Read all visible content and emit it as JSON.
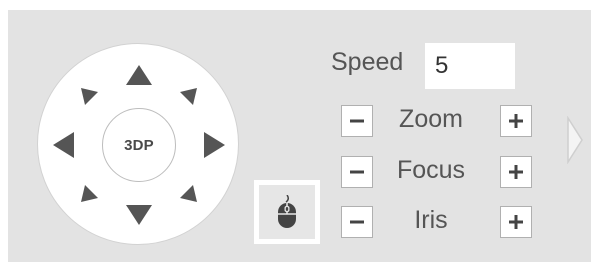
{
  "ptz": {
    "center_label": "3DP",
    "directions": [
      "up",
      "up-right",
      "right",
      "down-right",
      "down",
      "down-left",
      "left",
      "up-left"
    ]
  },
  "speed": {
    "label": "Speed",
    "value": "5"
  },
  "controls": [
    {
      "label": "Zoom"
    },
    {
      "label": "Focus"
    },
    {
      "label": "Iris"
    }
  ],
  "icons": {
    "mouse": "mouse-icon",
    "expand": "chevron-right-icon",
    "minus": "minus-icon",
    "plus": "plus-icon"
  },
  "colors": {
    "panel": "#e3e3e3",
    "arrow": "#555555",
    "text": "#555555"
  }
}
